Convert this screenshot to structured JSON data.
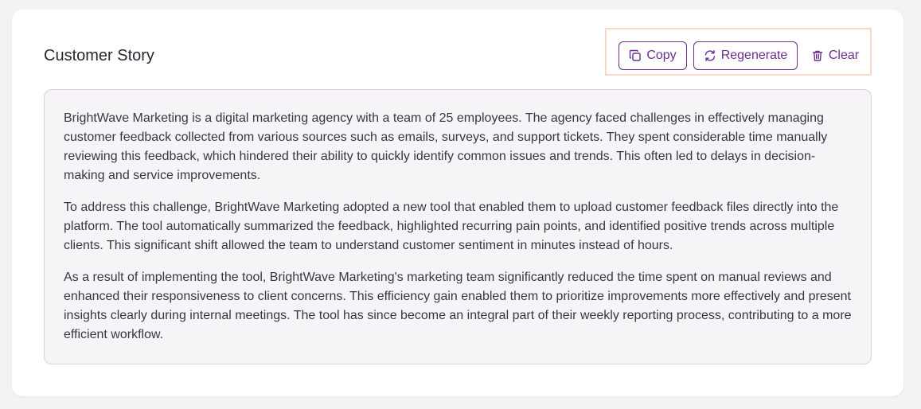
{
  "card": {
    "title": "Customer Story"
  },
  "toolbar": {
    "copy_label": "Copy",
    "regenerate_label": "Regenerate",
    "clear_label": "Clear",
    "copy_icon": "copy-icon",
    "regenerate_icon": "refresh-icon",
    "clear_icon": "trash-icon"
  },
  "story": {
    "paragraphs": [
      "BrightWave Marketing is a digital marketing agency with a team of 25 employees. The agency faced challenges in effectively managing customer feedback collected from various sources such as emails, surveys, and support tickets. They spent considerable time manually reviewing this feedback, which hindered their ability to quickly identify common issues and trends. This often led to delays in decision-making and service improvements.",
      "To address this challenge, BrightWave Marketing adopted a new tool that enabled them to upload customer feedback files directly into the platform. The tool automatically summarized the feedback, highlighted recurring pain points, and identified positive trends across multiple clients. This significant shift allowed the team to understand customer sentiment in minutes instead of hours.",
      "As a result of implementing the tool, BrightWave Marketing's marketing team significantly reduced the time spent on manual reviews and enhanced their responsiveness to client concerns. This efficiency gain enabled them to prioritize improvements more effectively and present insights clearly during internal meetings. The tool has since become an integral part of their weekly reporting process, contributing to a more efficient workflow."
    ]
  },
  "colors": {
    "accent": "#6b2f8f",
    "highlight_border": "#fbd7c9",
    "story_background": "#f6f4f7"
  }
}
